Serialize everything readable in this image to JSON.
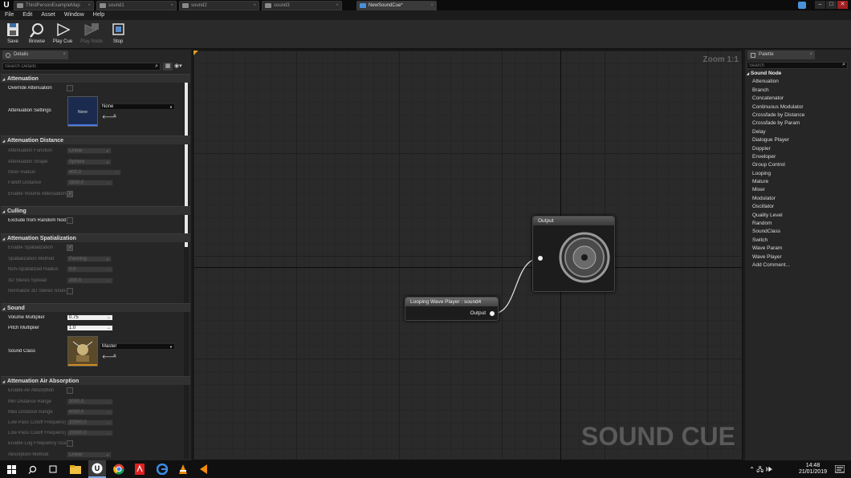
{
  "titlebar": {
    "tabs": [
      "ThirdPersonExampleMap",
      "sound1",
      "sound2",
      "sound3",
      "NewSoundCue*"
    ],
    "controls": [
      "–",
      "□",
      "✕"
    ]
  },
  "menu": [
    "File",
    "Edit",
    "Asset",
    "Window",
    "Help"
  ],
  "toolbar": {
    "buttons": [
      "Save",
      "Browse",
      "Play Cue",
      "Play Node",
      "Stop"
    ]
  },
  "details": {
    "tab_label": "Details",
    "search_placeholder": "Search Details",
    "attenuation": {
      "header": "Attenuation",
      "override_label": "Override Attenuation",
      "settings_label": "Attenuation Settings",
      "thumb_text": "None",
      "settings_value": "None"
    },
    "attenuation_distance": {
      "header": "Attenuation Distance",
      "rows": [
        {
          "label": "Attenuation Function",
          "value": "Linear"
        },
        {
          "label": "Attenuation Shape",
          "value": "Sphere"
        },
        {
          "label": "Inner Radius",
          "value": "400.0"
        },
        {
          "label": "Falloff Distance",
          "value": "3600.0"
        }
      ],
      "enable_label": "Enable Volume Attenuation"
    },
    "culling": {
      "header": "Culling",
      "exclude_label": "Exclude from Random Node Branch Culling"
    },
    "spatialization": {
      "header": "Attenuation Spatialization",
      "enable_label": "Enable Spatialization",
      "method_label": "Spatialization Method",
      "method_value": "Panning",
      "radius_label": "Non-Spatialized Radius",
      "radius_value": "0.0",
      "spread_label": "3D Stereo Spread",
      "spread_value": "200.0",
      "normalize_label": "Normalize 3D Stereo Sounds"
    },
    "sound": {
      "header": "Sound",
      "volume_label": "Volume Multiplier",
      "volume_value": "0.75",
      "pitch_label": "Pitch Multiplier",
      "pitch_value": "1.0",
      "class_label": "Sound Class",
      "class_value": "Master"
    },
    "air_absorption": {
      "header": "Attenuation Air Absorption",
      "enable_label": "Enable Air Absorption",
      "min_label": "Min Distance Range",
      "min_value": "3000.0",
      "max_label": "Max Distance Range",
      "max_value": "6000.0",
      "lp_min_label": "Low Pass Cutoff Frequency Min",
      "lp_min_value": "20000.0",
      "lp_max_label": "Low Pass Cutoff Frequency Max",
      "lp_max_value": "20000.0",
      "log_label": "Enable Log Frequency Scaling",
      "method_label": "Absorption Method",
      "method_value": "Linear"
    }
  },
  "graph": {
    "zoom": "Zoom 1:1",
    "watermark": "SOUND CUE",
    "output_node": {
      "title": "Output"
    },
    "wave_node": {
      "title": "Looping Wave Player : sound4",
      "pin": "Output"
    }
  },
  "palette": {
    "tab_label": "Palette",
    "search_placeholder": "Search",
    "root": "Sound Node",
    "items": [
      "Attenuation",
      "Branch",
      "Concatenator",
      "Continuous Modulator",
      "Crossfade by Distance",
      "Crossfade by Param",
      "Delay",
      "Dialogue Player",
      "Doppler",
      "Enveloper",
      "Group Control",
      "Looping",
      "Mature",
      "Mixer",
      "Modulator",
      "Oscillator",
      "Quality Level",
      "Random",
      "SoundClass",
      "Switch",
      "Wave Param",
      "Wave Player",
      "Add Comment..."
    ]
  },
  "taskbar": {
    "time": "14:48",
    "date": "21/01/2019"
  }
}
